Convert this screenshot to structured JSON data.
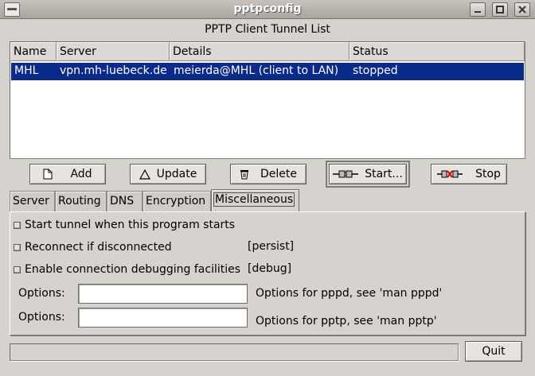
{
  "window": {
    "title": "pptpconfig",
    "controls": [
      "minimize-icon",
      "maximize-icon",
      "close-icon"
    ]
  },
  "list": {
    "caption": "PPTP Client Tunnel List",
    "columns": [
      "Name",
      "Server",
      "Details",
      "Status"
    ],
    "rows": [
      {
        "name": "MHL",
        "server": "vpn.mh-luebeck.de",
        "details": "meierda@MHL (client to LAN)",
        "status": "stopped",
        "selected": true
      }
    ]
  },
  "actions": {
    "add": "Add",
    "update": "Update",
    "delete": "Delete",
    "start": "Start...",
    "stop": "Stop"
  },
  "tabs": [
    "Server",
    "Routing",
    "DNS",
    "Encryption",
    "Miscellaneous"
  ],
  "active_tab": "Miscellaneous",
  "misc": {
    "start_tunnel": {
      "label": "Start tunnel when this program starts",
      "checked": false
    },
    "reconnect": {
      "label": "Reconnect if disconnected",
      "option": "[persist]",
      "checked": false
    },
    "debug": {
      "label": "Enable connection debugging facilities",
      "option": "[debug]",
      "checked": false
    },
    "pppd_options": {
      "label": "Options:",
      "value": "",
      "hint": "Options for pppd, see 'man pppd'"
    },
    "pptp_options": {
      "label": "Options:",
      "value": "",
      "hint": "Options for pptp, see 'man pptp'"
    }
  },
  "status_text": "",
  "quit": "Quit",
  "colors": {
    "selection": "#0a2a8c",
    "window_bg": "#d6d3ce"
  }
}
